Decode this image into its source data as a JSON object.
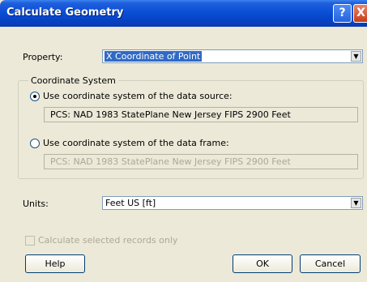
{
  "window": {
    "title": "Calculate Geometry",
    "help_symbol": "?",
    "close_symbol": "X"
  },
  "property": {
    "label": "Property:",
    "value": "X Coordinate of Point"
  },
  "coordinate_system": {
    "legend": "Coordinate System",
    "source_option": {
      "label": "Use coordinate system of the data source:",
      "value": "PCS: NAD 1983 StatePlane New Jersey FIPS 2900 Feet",
      "selected": true
    },
    "frame_option": {
      "label": "Use coordinate system of the data frame:",
      "value": "PCS: NAD 1983 StatePlane New Jersey FIPS 2900 Feet",
      "selected": false
    }
  },
  "units": {
    "label": "Units:",
    "value": "Feet US [ft]"
  },
  "selected_only": {
    "label": "Calculate selected records only",
    "checked": false
  },
  "buttons": {
    "help": "Help",
    "ok": "OK",
    "cancel": "Cancel"
  },
  "icons": {
    "dropdown": "▼"
  }
}
